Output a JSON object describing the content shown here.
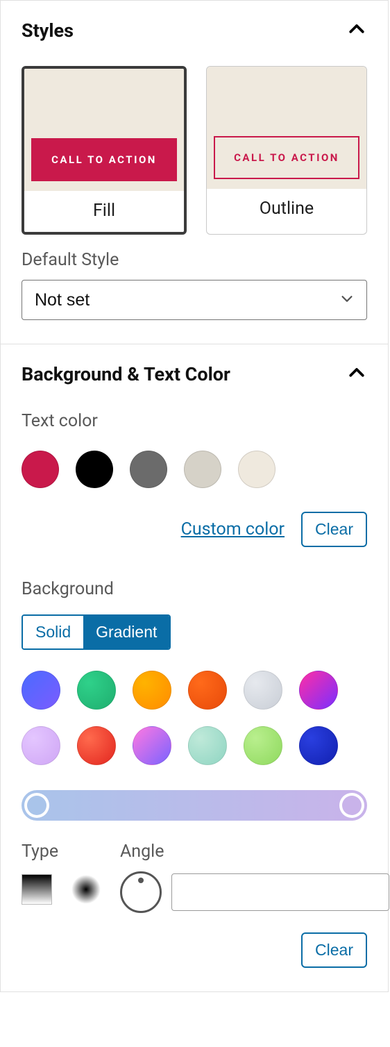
{
  "styles": {
    "title": "Styles",
    "options": {
      "fill": {
        "label": "Fill",
        "cta": "CALL TO ACTION",
        "selected": true
      },
      "outline": {
        "label": "Outline",
        "cta": "CALL TO ACTION",
        "selected": false
      }
    },
    "default_style_label": "Default Style",
    "default_style_value": "Not set"
  },
  "bgtext": {
    "title": "Background & Text Color",
    "text_color_label": "Text color",
    "text_swatches": [
      "#c9194b",
      "#000000",
      "#6b6b6b",
      "#d6d2c8",
      "#efe9de"
    ],
    "custom_color_label": "Custom color",
    "clear_label": "Clear",
    "background_label": "Background",
    "seg": {
      "solid": "Solid",
      "gradient": "Gradient",
      "active": "gradient"
    },
    "grad_swatches": [
      "linear-gradient(135deg,#4b6bff,#7a5cff)",
      "radial-gradient(circle at 30% 30%,#2fd18a,#1fae6f)",
      "radial-gradient(circle at 30% 30%,#ffb300,#ff8c00)",
      "radial-gradient(circle at 30% 30%,#ff6a1a,#e84a0a)",
      "radial-gradient(circle at 30% 30%,#e6e9ee,#c9ced6)",
      "linear-gradient(135deg,#ff2ea6,#7a2fff)",
      "radial-gradient(circle at 30% 30%,#e4c6ff,#cfa6f5)",
      "radial-gradient(circle at 30% 30%,#ff6a4d,#e2261f)",
      "linear-gradient(135deg,#ff79e1,#7a63ff)",
      "radial-gradient(circle at 30% 30%,#bfe9d9,#8fd5c2)",
      "radial-gradient(circle at 30% 30%,#b9ef8e,#8fd95e)",
      "radial-gradient(circle at 30% 30%,#2a3fe0,#1221b0)"
    ],
    "gradient_bar": {
      "from": "#a9c4ea",
      "to": "#c9b3ea"
    },
    "type_label": "Type",
    "angle_label": "Angle",
    "angle_value": ""
  }
}
